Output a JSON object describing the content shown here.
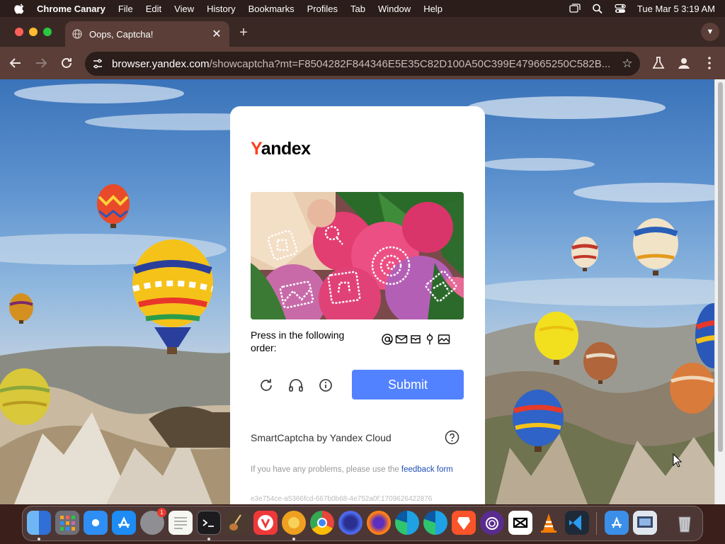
{
  "menubar": {
    "app_name": "Chrome Canary",
    "menus": [
      "File",
      "Edit",
      "View",
      "History",
      "Bookmarks",
      "Profiles",
      "Tab",
      "Window",
      "Help"
    ],
    "clock": "Tue Mar 5  3:19 AM"
  },
  "browser": {
    "tab_title": "Oops, Captcha!",
    "url_host": "browser.yandex.com",
    "url_path": "/showcaptcha?mt=F8504282F844346E5E35C82D100A50C399E479665250C582B..."
  },
  "captcha": {
    "logo_first": "Y",
    "logo_rest": "andex",
    "instruction": "Press in the following order:",
    "order_icons": [
      "at-sign-icon",
      "envelope-icon",
      "mailbox-icon",
      "location-pin-icon",
      "image-icon"
    ],
    "submit_label": "Submit",
    "brand_line": "SmartCaptcha by Yandex Cloud",
    "problems_text": "If you have any problems, please use the ",
    "problems_link": "feedback form",
    "session_id": "e3e754ce-a5366fcd-667b0b68-4e752a0f:1709626422876"
  },
  "colors": {
    "submit": "#5282ff",
    "logo_y": "#fc3f1d",
    "link": "#1f4fb4"
  },
  "dock": {
    "apps": [
      "finder-icon",
      "launchpad-icon",
      "safari-icon",
      "app-store-icon",
      "system-settings-icon",
      "textedit-icon",
      "terminal-icon",
      "instruments-icon",
      "vivaldi-icon",
      "chrome-canary-icon",
      "chrome-icon",
      "firefox-nightly-icon",
      "firefox-icon",
      "edge-icon",
      "edge-canary-icon",
      "brave-icon",
      "tor-browser-icon",
      "capcut-icon",
      "vlc-icon",
      "vscode-icon",
      "downloads-folder-icon",
      "screenshot-folder-icon",
      "trash-icon"
    ],
    "system_settings_badge": "1"
  }
}
